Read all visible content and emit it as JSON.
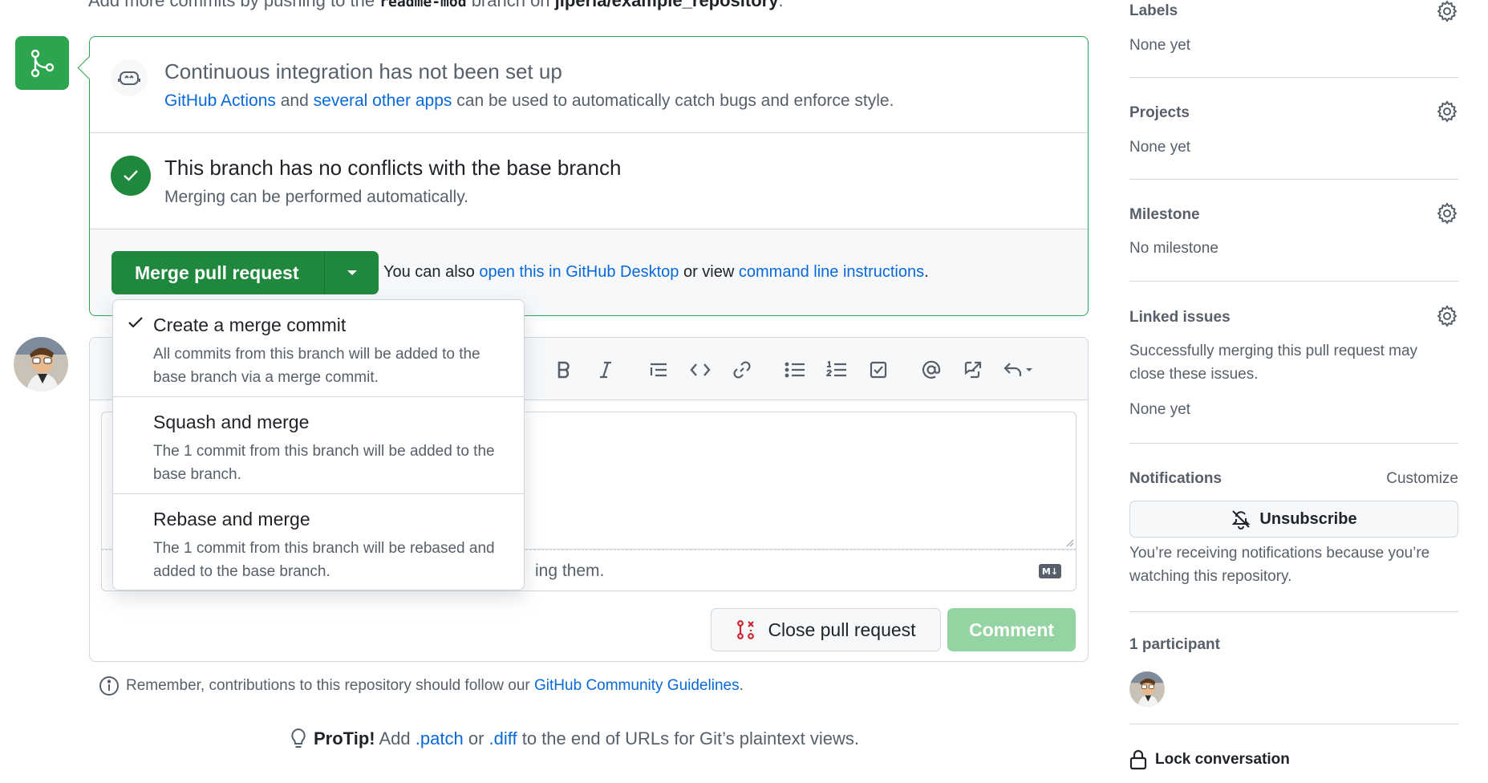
{
  "top": {
    "prefix": "Add more commits by pushing to the",
    "branch": "readme-mod",
    "middle": "branch on",
    "repo": "jiperia/example_repository",
    "suffix": "."
  },
  "ci": {
    "title": "Continuous integration has not been set up",
    "link1": "GitHub Actions",
    "and": "and",
    "link2": "several other apps",
    "rest": "can be used to automatically catch bugs and enforce style."
  },
  "conflicts": {
    "title": "This branch has no conflicts with the base branch",
    "sub": "Merging can be performed automatically."
  },
  "merge": {
    "button": "Merge pull request",
    "also_prefix": "You can also",
    "desktop_link": "open this in GitHub Desktop",
    "or_view": "or view",
    "cli_link": "command line instructions",
    "period": "."
  },
  "dropdown": {
    "items": [
      {
        "title": "Create a merge commit",
        "desc": "All commits from this branch will be added to the base branch via a merge commit.",
        "selected": true
      },
      {
        "title": "Squash and merge",
        "desc": "The 1 commit from this branch will be added to the base branch.",
        "selected": false
      },
      {
        "title": "Rebase and merge",
        "desc": "The 1 commit from this branch will be rebased and added to the base branch.",
        "selected": false
      }
    ]
  },
  "editor": {
    "footer_fragment": "ing them."
  },
  "actions": {
    "close": "Close pull request",
    "comment": "Comment"
  },
  "remember": {
    "text": "Remember, contributions to this repository should follow our",
    "link": "GitHub Community Guidelines",
    "period": "."
  },
  "protip": {
    "label": "ProTip!",
    "add": "Add",
    "patch": ".patch",
    "or": "or",
    "diff": ".diff",
    "rest": "to the end of URLs for Git’s plaintext views."
  },
  "sidebar": {
    "labels": {
      "title": "Labels",
      "value": "None yet"
    },
    "projects": {
      "title": "Projects",
      "value": "None yet"
    },
    "milestone": {
      "title": "Milestone",
      "value": "No milestone"
    },
    "linked": {
      "title": "Linked issues",
      "desc": "Successfully merging this pull request may close these issues.",
      "value": "None yet"
    },
    "notifications": {
      "title": "Notifications",
      "customize": "Customize",
      "unsubscribe": "Unsubscribe",
      "reason": "You’re receiving notifications because you’re watching this repository."
    },
    "participants": {
      "title": "1 participant"
    },
    "lock": "Lock conversation"
  },
  "colors": {
    "green": "#1f883d",
    "link": "#0969da",
    "muted": "#57606a",
    "disabled_green": "#94d3a2",
    "danger": "#cf222e"
  }
}
